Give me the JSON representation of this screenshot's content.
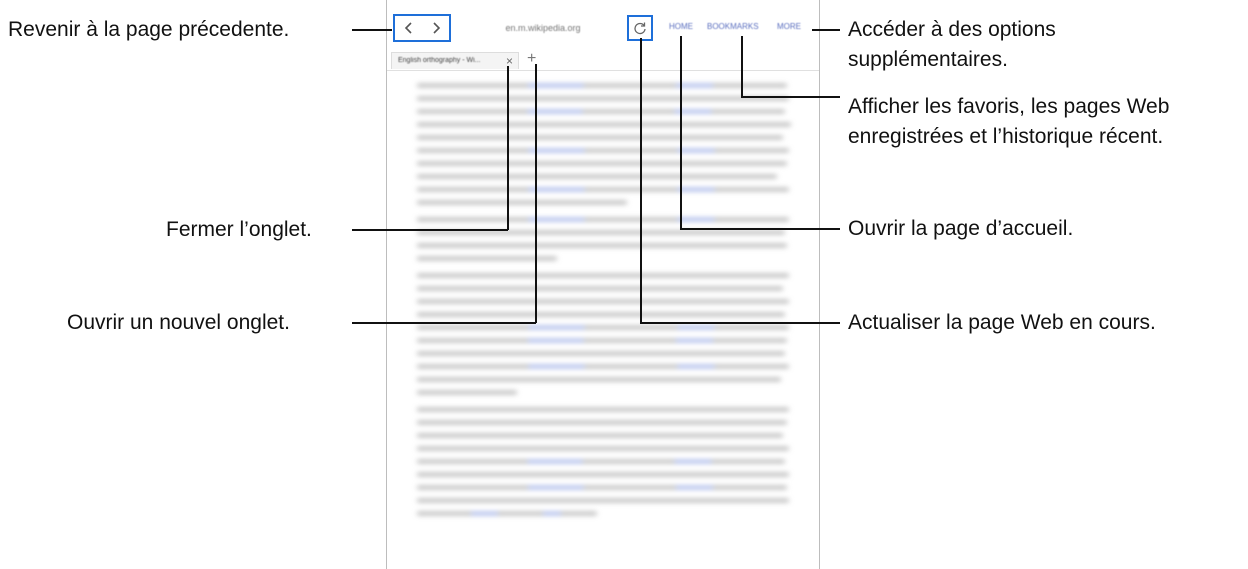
{
  "browser": {
    "address": "en.m.wikipedia.org",
    "toolbar": {
      "home": "HOME",
      "bookmarks": "BOOKMARKS",
      "more": "MORE"
    },
    "tab_title": "English orthography - Wi...",
    "tab_close": "×",
    "new_tab": "+",
    "back_icon": "chevron-left-icon",
    "forward_icon": "chevron-right-icon",
    "reload_icon": "reload-icon",
    "accent": "#1e6fd9"
  },
  "callouts": {
    "back": "Revenir à la page précedente.",
    "close_tab": "Fermer l’onglet.",
    "new_tab": "Ouvrir un nouvel onglet.",
    "more": "Accéder à des options supplémentaires.",
    "bookmarks": "Afficher les favoris, les pages Web enregistrées et l’historique récent.",
    "home": "Ouvrir la page d’accueil.",
    "reload": "Actualiser la page Web en cours."
  }
}
